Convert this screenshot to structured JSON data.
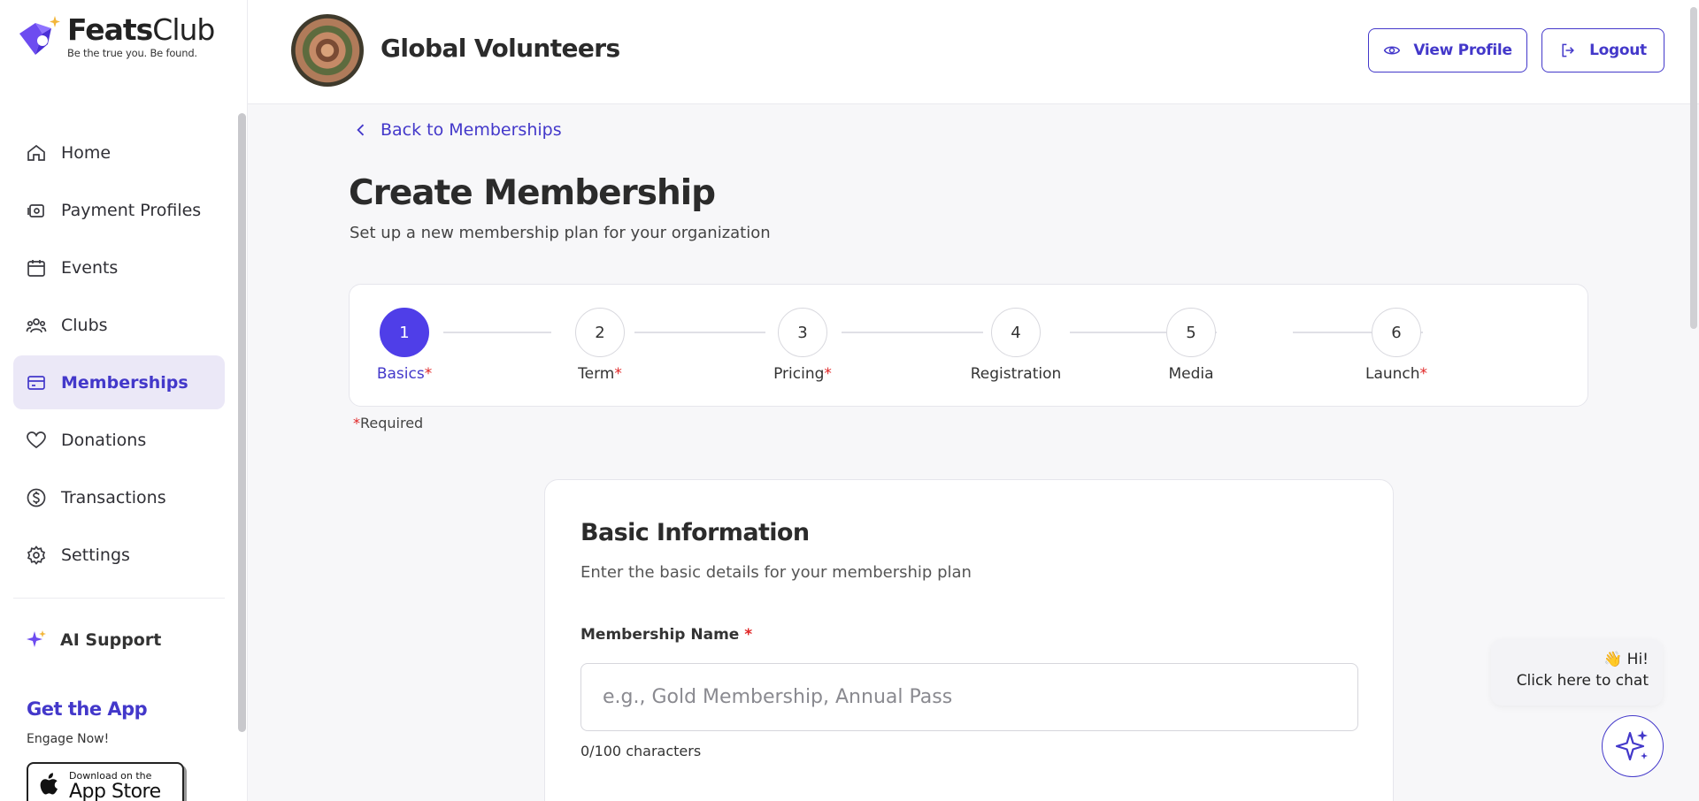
{
  "brand": {
    "name_bold": "Feats",
    "name_light": "Club",
    "tagline": "Be the true you. Be found."
  },
  "sidebar": {
    "items": [
      {
        "label": "Home",
        "icon": "home-icon",
        "active": false
      },
      {
        "label": "Payment Profiles",
        "icon": "payment-profile-icon",
        "active": false
      },
      {
        "label": "Events",
        "icon": "calendar-icon",
        "active": false
      },
      {
        "label": "Clubs",
        "icon": "users-icon",
        "active": false
      },
      {
        "label": "Memberships",
        "icon": "card-icon",
        "active": true
      },
      {
        "label": "Donations",
        "icon": "heart-icon",
        "active": false
      },
      {
        "label": "Transactions",
        "icon": "dollar-icon",
        "active": false
      },
      {
        "label": "Settings",
        "icon": "gear-icon",
        "active": false
      }
    ],
    "ai_support": "AI Support",
    "get_app": "Get the App",
    "engage": "Engage Now!",
    "appstore_small": "Download on the",
    "appstore_big": "App Store"
  },
  "header": {
    "org_name": "Global Volunteers",
    "view_profile": "View Profile",
    "logout": "Logout"
  },
  "main": {
    "back_link": "Back to Memberships",
    "title": "Create Membership",
    "subtitle": "Set up a new membership plan for your organization",
    "required_note": "Required",
    "steps": [
      {
        "number": "1",
        "label": "Basics",
        "required": true,
        "active": true
      },
      {
        "number": "2",
        "label": "Term",
        "required": true,
        "active": false
      },
      {
        "number": "3",
        "label": "Pricing",
        "required": true,
        "active": false
      },
      {
        "number": "4",
        "label": "Registration",
        "required": false,
        "active": false
      },
      {
        "number": "5",
        "label": "Media",
        "required": false,
        "active": false
      },
      {
        "number": "6",
        "label": "Launch",
        "required": true,
        "active": false
      }
    ]
  },
  "form": {
    "title": "Basic Information",
    "subtitle": "Enter the basic details for your membership plan",
    "name_label": "Membership Name",
    "name_placeholder": "e.g., Gold Membership, Annual Pass",
    "name_value": "",
    "char_count": "0/100 characters"
  },
  "chat": {
    "greeting": "👋 Hi!",
    "prompt": "Click here to chat"
  },
  "colors": {
    "accent": "#4338ca",
    "active_step": "#4f3ee8",
    "required": "#e02424",
    "active_nav_bg": "#ebe8f7"
  }
}
